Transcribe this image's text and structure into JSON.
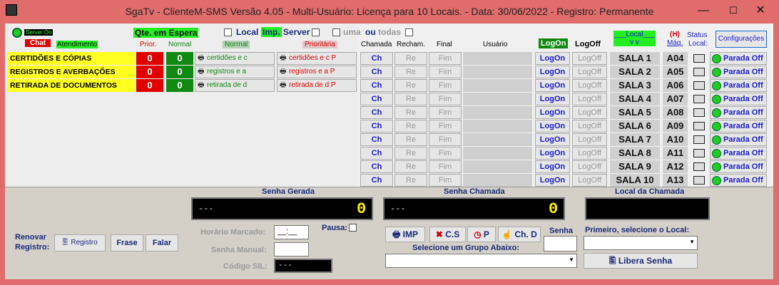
{
  "window": {
    "title": "SgaTv - ClienteM-SMS  Versão 4.05 - Multi-Usuário: Licença para 10 Locais.  - Data: 30/06/2022 - Registro: Permanente",
    "minimize": "—",
    "maximize": "☐",
    "close": "✕"
  },
  "status": {
    "server_label": "Server On",
    "chat_label": "Chat",
    "atendimento_label": "Atendimento"
  },
  "header": {
    "qte_espera": "Qte. em Espera",
    "local_label": "Local",
    "imp_label": "Imp.",
    "server_label": "Server",
    "uma_label": "uma",
    "ou_label": "ou",
    "todas_label": "todas",
    "prior": "Prior.",
    "normal": "Normal",
    "normal_btn": "Normal",
    "prioritaria": "Prioritária",
    "chamada": "Chamada",
    "rechamada": "Recham.",
    "final": "Final",
    "usuario": "Usuário",
    "logon": "LogOn",
    "logoff": "LogOff",
    "local_col": "___Local___",
    "local_col2": "v        v",
    "h_label": "(H)",
    "maq_label": "Máq.",
    "status_label": "Status",
    "status_label2": "Local:",
    "config_btn": "Configurações"
  },
  "services": [
    {
      "name": "CERTIDÕES E CÓPIAS",
      "prior": "0",
      "normal": "0",
      "normal_btn": "certidões e c",
      "prior_btn": "certidões e c P"
    },
    {
      "name": "REGISTROS E AVERBAÇÕES",
      "prior": "0",
      "normal": "0",
      "normal_btn": "registros e a",
      "prior_btn": "registros e a P"
    },
    {
      "name": "RETIRADA DE DOCUMENTOS",
      "prior": "0",
      "normal": "0",
      "normal_btn": "retirada de d",
      "prior_btn": "retirada de d P"
    }
  ],
  "row_buttons": {
    "ch": "Ch",
    "re": "Re",
    "fim": "Fim",
    "logon": "LogOn",
    "logoff": "LogOff",
    "parada": "Parada Off"
  },
  "locais": [
    {
      "sala": "SALA 1",
      "maq": "A04"
    },
    {
      "sala": "SALA 2",
      "maq": "A05"
    },
    {
      "sala": "SALA 3",
      "maq": "A06"
    },
    {
      "sala": "SALA 4",
      "maq": "A07"
    },
    {
      "sala": "SALA 5",
      "maq": "A08"
    },
    {
      "sala": "SALA 6",
      "maq": "A09"
    },
    {
      "sala": "SALA 7",
      "maq": "A10"
    },
    {
      "sala": "SALA 8",
      "maq": "A11"
    },
    {
      "sala": "SALA 9",
      "maq": "A12"
    },
    {
      "sala": "SALA 10",
      "maq": "A13"
    }
  ],
  "bottom": {
    "senha_gerada": "Senha Gerada",
    "senha_chamada": "Senha Chamada",
    "local_chamada": "Local da Chamada",
    "gerada_value": "---",
    "gerada_digit": "0",
    "chamada_value": "---",
    "chamada_digit": "0",
    "renovar": "Renovar",
    "registro_lbl": "Registro:",
    "registro_btn": "Registro",
    "frase_btn": "Frase",
    "falar_btn": "Falar",
    "horario": "Horário Marcado:",
    "horario_value": "__:__",
    "senha_manual": "Senha Manual:",
    "codigo_sil": "Código SIL:",
    "codigo_value": "---",
    "pausa": "Pausa:",
    "imp_btn": "IMP",
    "cs_btn": "C.S",
    "p_btn": "P",
    "chd_btn": "Ch. D",
    "senha_lbl": "Senha",
    "primeiro_lbl": "Primeiro, selecione o Local:",
    "grupo_lbl": "Selecione um Grupo Abaixo:",
    "libera_btn": "Libera Senha"
  }
}
